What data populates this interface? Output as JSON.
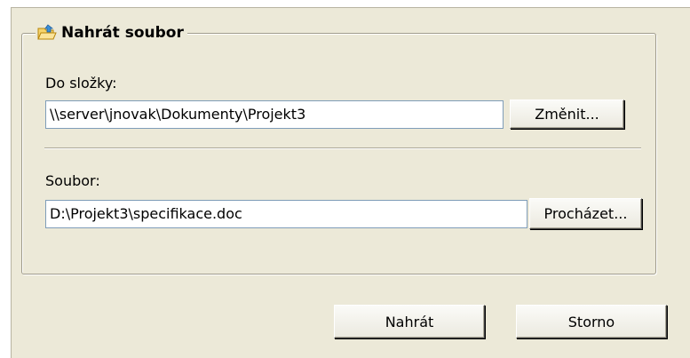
{
  "dialog": {
    "group_title": "Nahrát soubor",
    "folder_label": "Do složky:",
    "folder_value": "\\\\server\\jnovak\\Dokumenty\\Projekt3",
    "change_button": "Změnit...",
    "file_label": "Soubor:",
    "file_value": "D:\\Projekt3\\specifikace.doc",
    "browse_button": "Procházet...",
    "upload_button": "Nahrát",
    "cancel_button": "Storno"
  },
  "icons": {
    "group_icon": "folder-upload-icon"
  },
  "colors": {
    "dialog_background": "#ece9d8",
    "textbox_border": "#7f9db9"
  }
}
